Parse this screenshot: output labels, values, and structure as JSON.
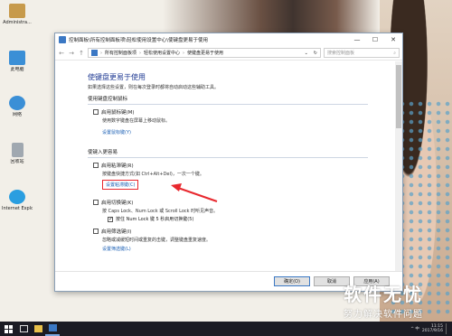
{
  "desktop": {
    "icons": [
      {
        "label": "Administra...",
        "icon": "user-folder-icon",
        "color": "#c79a4b"
      },
      {
        "label": "此电脑",
        "icon": "computer-icon",
        "color": "#3b8fd6"
      },
      {
        "label": "网络",
        "icon": "network-icon",
        "color": "#3b8fd6"
      },
      {
        "label": "回收站",
        "icon": "recycle-bin-icon",
        "color": "#a0a8b0"
      },
      {
        "label": "Internet Explorer",
        "icon": "ie-icon",
        "color": "#2a9ee0"
      }
    ]
  },
  "window": {
    "title": "控制面板\\所有控制面板项\\轻松使用设置中心\\使键盘更易于使用",
    "minimize": "—",
    "maximize": "☐",
    "close": "✕",
    "address": {
      "crumbs": [
        "所有控制面板项",
        "轻松使用设置中心",
        "使键盘更易于使用"
      ],
      "dropdown": "⌄",
      "refresh": "↻"
    },
    "search_placeholder": "搜索控制面板",
    "page_title": "使键盘更易于使用",
    "page_desc": "如果选择这些设置，则在每次登录时都将自动启动这些辅助工具。",
    "sections": {
      "mouse_keys": {
        "heading": "使用键盘控制鼠标",
        "option_label": "启用鼠标键(M)",
        "desc": "使用数字键盘在屏幕上移动鼠标。",
        "link": "设置鼠标键(Y)"
      },
      "typing": {
        "heading": "使键入更容易",
        "sticky_label": "启用粘滞键(R)",
        "sticky_desc": "按键盘快捷方式(如 Ctrl+Alt+Del)，一次一个键。",
        "sticky_link": "设置粘滞键(C)",
        "toggle_label": "启用切换键(K)",
        "toggle_desc": "按 Caps Lock、Num Lock 或 Scroll Lock 时听见声音。",
        "toggle_sub": "按住 Num Lock 键 5 秒启用切换键(5)",
        "filter_label": "启用筛选键(I)",
        "filter_desc": "忽略或减缓短时间或重复的击键，调整键盘重复速度。",
        "filter_link": "设置筛选键(L)"
      }
    },
    "buttons": {
      "ok": "确定(O)",
      "cancel": "取消",
      "apply": "应用(A)"
    }
  },
  "watermark": {
    "title": "软件无忧",
    "subtitle": "努力解决软件问题"
  },
  "taskbar": {
    "clock_time": "11:15",
    "clock_date": "2017/9/16",
    "tray_text": "^ 中"
  },
  "colors": {
    "link": "#1a5fb4",
    "title": "#1f3a93",
    "annotation": "#e8282e",
    "taskbar": "#1b1b24"
  }
}
